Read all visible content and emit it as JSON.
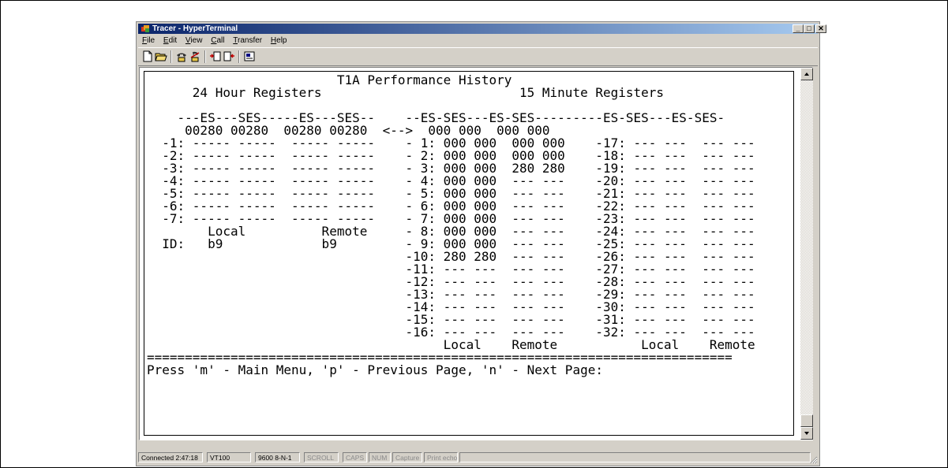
{
  "window": {
    "title": "Tracer - HyperTerminal"
  },
  "title_buttons": {
    "minimize": "_",
    "maximize": "□",
    "close": "✕"
  },
  "menu": {
    "items": [
      {
        "mnemonic": "F",
        "rest": "ile"
      },
      {
        "mnemonic": "E",
        "rest": "dit"
      },
      {
        "mnemonic": "V",
        "rest": "iew"
      },
      {
        "mnemonic": "C",
        "rest": "all"
      },
      {
        "mnemonic": "T",
        "rest": "ransfer"
      },
      {
        "mnemonic": "H",
        "rest": "elp"
      }
    ]
  },
  "toolbar": {
    "buttons": [
      "new-document",
      "open-folder",
      "connect-phone",
      "disconnect-phone",
      "send-file",
      "receive-file",
      "properties"
    ]
  },
  "terminal": {
    "lines": [
      "                         T1A Performance History",
      "      24 Hour Registers                          15 Minute Registers",
      "",
      "    ---ES---SES-----ES---SES--    --ES-SES---ES-SES---------ES-SES---ES-SES-",
      "     00280 00280  00280 00280  <-->  000 000  000 000",
      "  -1: ----- -----  ----- -----    - 1: 000 000  000 000    -17: --- ---  --- ---",
      "  -2: ----- -----  ----- -----    - 2: 000 000  000 000    -18: --- ---  --- ---",
      "  -3: ----- -----  ----- -----    - 3: 000 000  280 280    -19: --- ---  --- ---",
      "  -4: ----- -----  ----- -----    - 4: 000 000  --- ---    -20: --- ---  --- ---",
      "  -5: ----- -----  ----- -----    - 5: 000 000  --- ---    -21: --- ---  --- ---",
      "  -6: ----- -----  ----- -----    - 6: 000 000  --- ---    -22: --- ---  --- ---",
      "  -7: ----- -----  ----- -----    - 7: 000 000  --- ---    -23: --- ---  --- ---",
      "        Local          Remote     - 8: 000 000  --- ---    -24: --- ---  --- ---",
      "  ID:   b9             b9         - 9: 000 000  --- ---    -25: --- ---  --- ---",
      "                                  -10: 280 280  --- ---    -26: --- ---  --- ---",
      "                                  -11: --- ---  --- ---    -27: --- ---  --- ---",
      "                                  -12: --- ---  --- ---    -28: --- ---  --- ---",
      "                                  -13: --- ---  --- ---    -29: --- ---  --- ---",
      "                                  -14: --- ---  --- ---    -30: --- ---  --- ---",
      "                                  -15: --- ---  --- ---    -31: --- ---  --- ---",
      "                                  -16: --- ---  --- ---    -32: --- ---  --- ---",
      "                                       Local    Remote           Local    Remote",
      "=============================================================================",
      "Press 'm' - Main Menu, 'p' - Previous Page, 'n' - Next Page:"
    ]
  },
  "status": {
    "connected": "Connected 2:47:18",
    "emulation": "VT100",
    "settings": "9600 8-N-1",
    "scroll": "SCROLL",
    "caps": "CAPS",
    "num": "NUM",
    "capture": "Capture",
    "print_echo": "Print echo"
  }
}
